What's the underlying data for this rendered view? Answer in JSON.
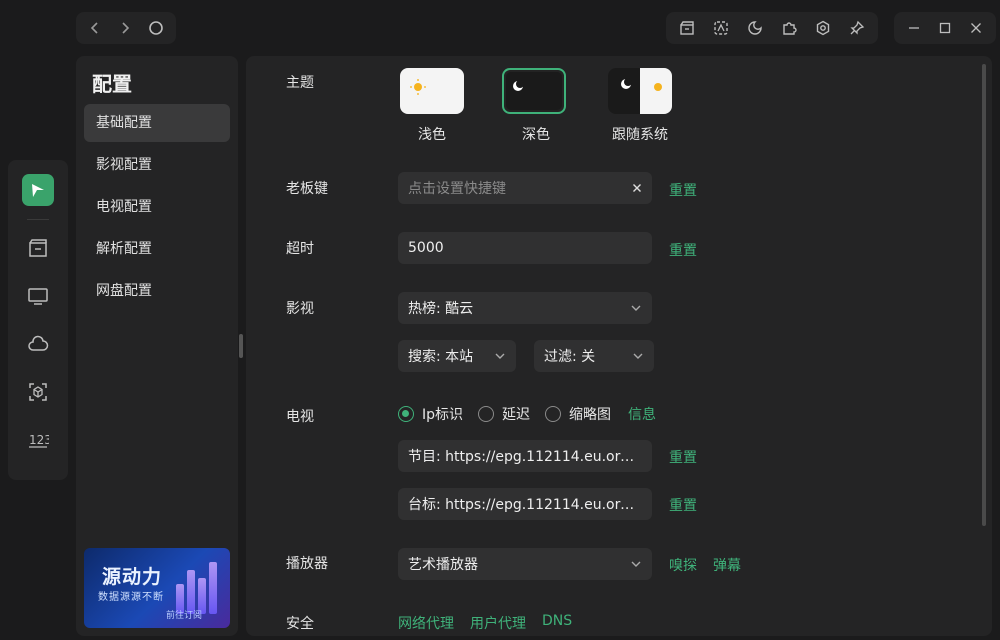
{
  "side": {
    "title": "配置",
    "items": [
      "基础配置",
      "影视配置",
      "电视配置",
      "解析配置",
      "网盘配置"
    ],
    "promo": {
      "title": "源动力",
      "subtitle": "数据源源不断",
      "cta": "前往订阅"
    }
  },
  "labels": {
    "theme": "主题",
    "boss_key": "老板键",
    "timeout": "超时",
    "film": "影视",
    "tv": "电视",
    "player": "播放器",
    "security": "安全"
  },
  "theme": {
    "light": "浅色",
    "dark": "深色",
    "system": "跟随系统",
    "selected": "深色"
  },
  "boss_key": {
    "placeholder": "点击设置快捷键",
    "reset": "重置"
  },
  "timeout": {
    "value": "5000",
    "reset": "重置"
  },
  "film": {
    "hot": "热榜: 酷云",
    "search": "搜索: 本站",
    "filter": "过滤: 关"
  },
  "tv": {
    "radios": [
      "Ip标识",
      "延迟",
      "缩略图"
    ],
    "selected": "Ip标识",
    "info": "信息",
    "epg": "节目: https://epg.112114.eu.org/?c...",
    "logo": "台标: https://epg.112114.eu.org/lo...",
    "reset": "重置"
  },
  "player": {
    "value": "艺术播放器",
    "sniff": "嗅探",
    "danmaku": "弹幕"
  },
  "security": {
    "proxy": "网络代理",
    "ua": "用户代理",
    "dns": "DNS"
  },
  "colors": {
    "accent": "#3fb27a",
    "panel": "#242425",
    "field": "#303031"
  }
}
